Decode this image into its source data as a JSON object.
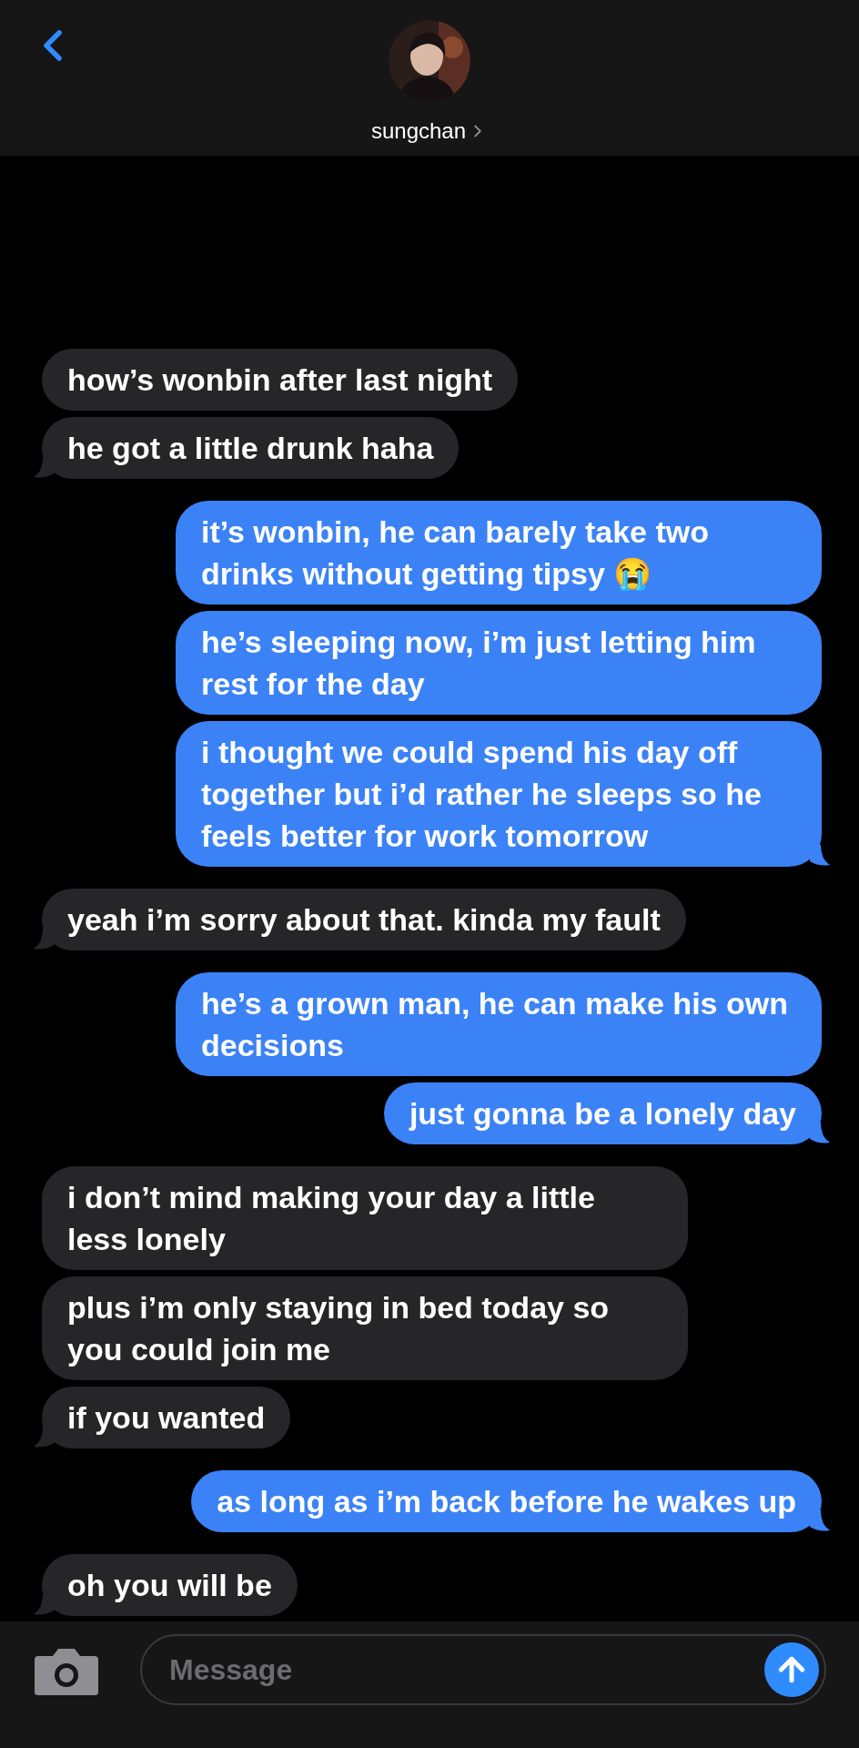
{
  "header": {
    "contact_name": "sungchan"
  },
  "messages": [
    {
      "kind": "received",
      "text": "how’s wonbin after last night",
      "tail": false
    },
    {
      "kind": "received",
      "text": "he got a little drunk haha",
      "tail": true
    },
    {
      "kind": "sent",
      "text": "it’s wonbin, he can barely take two drinks without getting tipsy 😭",
      "tail": false
    },
    {
      "kind": "sent",
      "text": "he’s sleeping now, i’m just letting him rest for the day",
      "tail": false
    },
    {
      "kind": "sent",
      "text": "i thought we could spend his day off together but i’d rather he sleeps so he feels better for work tomorrow",
      "tail": true
    },
    {
      "kind": "received",
      "text": "yeah i’m sorry about that. kinda my fault",
      "tail": true
    },
    {
      "kind": "sent",
      "text": "he’s a grown man, he can make his own decisions",
      "tail": false
    },
    {
      "kind": "sent",
      "text": "just gonna be a lonely day",
      "tail": true
    },
    {
      "kind": "received",
      "text": "i don’t mind making your day a little less lonely",
      "tail": false
    },
    {
      "kind": "received",
      "text": "plus i’m only staying in bed today so you could join me",
      "tail": false
    },
    {
      "kind": "received",
      "text": "if you wanted",
      "tail": true
    },
    {
      "kind": "sent",
      "text": "as long as i’m back before he wakes up",
      "tail": true
    },
    {
      "kind": "received",
      "text": "oh you will be",
      "tail": true
    }
  ],
  "composer": {
    "placeholder": "Message"
  }
}
